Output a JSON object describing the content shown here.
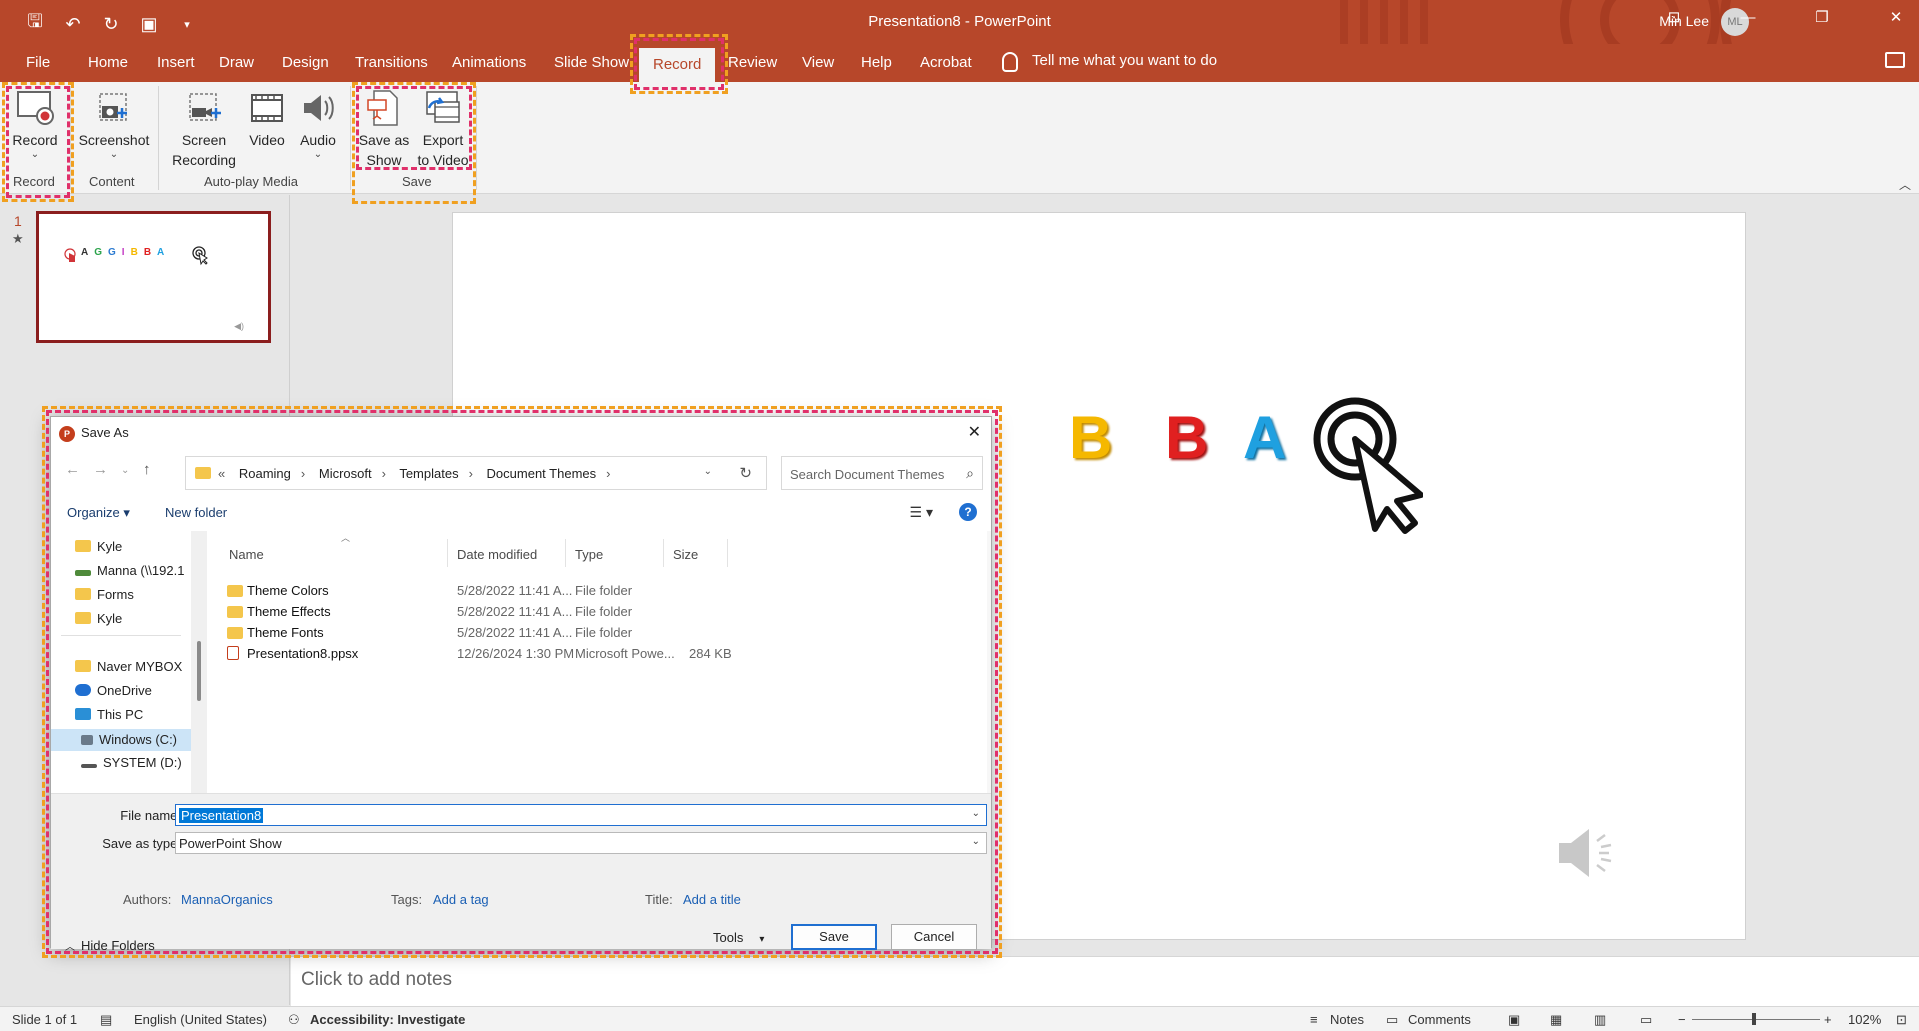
{
  "title_bar": {
    "doc_title": "Presentation8  -  PowerPoint",
    "user_name": "Min Lee",
    "user_initials": "ML"
  },
  "tabs": [
    "File",
    "Home",
    "Insert",
    "Draw",
    "Design",
    "Transitions",
    "Animations",
    "Slide Show",
    "Record",
    "Review",
    "View",
    "Help",
    "Acrobat"
  ],
  "active_tab": "Record",
  "tell_me": "Tell me what you want to do",
  "ribbon": {
    "record": {
      "label": "Record",
      "group": "Record"
    },
    "screenshot": {
      "label": "Screenshot",
      "group": "Content"
    },
    "screen_recording": {
      "label1": "Screen",
      "label2": "Recording"
    },
    "video": {
      "label": "Video"
    },
    "audio": {
      "label": "Audio"
    },
    "autoplay_group": "Auto-play Media",
    "save_as_show": {
      "label1": "Save as",
      "label2": "Show"
    },
    "export_video": {
      "label1": "Export",
      "label2": "to Video"
    },
    "save_group": "Save"
  },
  "thumbnail": {
    "slide_number": "1",
    "letters": [
      "A",
      "G",
      "G",
      "I",
      "B",
      "B",
      "A"
    ]
  },
  "slide": {
    "letters": [
      {
        "char": "B",
        "color": "#f5b800"
      },
      {
        "char": "B",
        "color": "#e02020"
      },
      {
        "char": "A",
        "color": "#1fa0e0"
      }
    ]
  },
  "notes_placeholder": "Click to add notes",
  "status_bar": {
    "slide_info": "Slide 1 of 1",
    "language": "English (United States)",
    "accessibility": "Accessibility: Investigate",
    "notes": "Notes",
    "comments": "Comments",
    "zoom": "102%"
  },
  "dialog": {
    "title": "Save As",
    "path": [
      "Roaming",
      "Microsoft",
      "Templates",
      "Document Themes"
    ],
    "search_placeholder": "Search Document Themes",
    "organize": "Organize ▾",
    "new_folder": "New folder",
    "nav_items": [
      {
        "label": "Kyle",
        "icon": "folder"
      },
      {
        "label": "Manna (\\\\192.1",
        "icon": "network-drive"
      },
      {
        "label": "Forms",
        "icon": "folder"
      },
      {
        "label": "Kyle",
        "icon": "folder"
      },
      {
        "label": "Naver MYBOX",
        "icon": "folder"
      },
      {
        "label": "OneDrive",
        "icon": "cloud"
      },
      {
        "label": "This PC",
        "icon": "pc"
      },
      {
        "label": "Windows (C:)",
        "icon": "drive"
      },
      {
        "label": "SYSTEM  (D:)",
        "icon": "drive"
      }
    ],
    "columns": {
      "name": "Name",
      "date": "Date modified",
      "type": "Type",
      "size": "Size"
    },
    "files": [
      {
        "name": "Theme Colors",
        "date": "5/28/2022 11:41 A...",
        "type": "File folder",
        "size": ""
      },
      {
        "name": "Theme Effects",
        "date": "5/28/2022 11:41 A...",
        "type": "File folder",
        "size": ""
      },
      {
        "name": "Theme Fonts",
        "date": "5/28/2022 11:41 A...",
        "type": "File folder",
        "size": ""
      },
      {
        "name": "Presentation8.ppsx",
        "date": "12/26/2024 1:30 PM",
        "type": "Microsoft Powe...",
        "size": "284 KB"
      }
    ],
    "file_name_label": "File name:",
    "file_name": "Presentation8",
    "save_type_label": "Save as type:",
    "save_type": "PowerPoint Show",
    "authors_label": "Authors:",
    "authors": "MannaOrganics",
    "tags_label": "Tags:",
    "tags": "Add a tag",
    "title_label": "Title:",
    "title_value": "Add a title",
    "hide_folders": "Hide Folders",
    "tools": "Tools",
    "save": "Save",
    "cancel": "Cancel"
  },
  "colors": {
    "accent": "#b7472a",
    "highlight_orange": "#f0a020",
    "highlight_pink": "#e0306a"
  }
}
